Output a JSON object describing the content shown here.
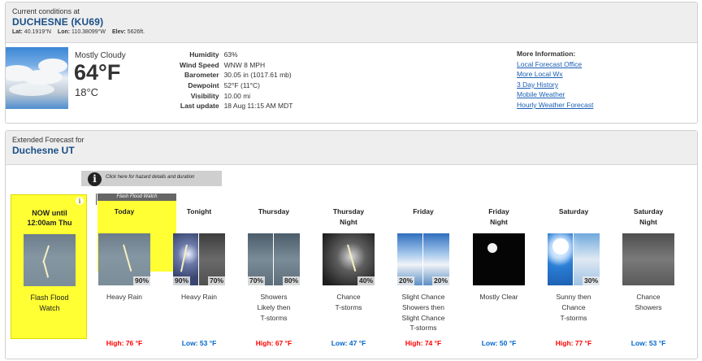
{
  "current": {
    "header_label": "Current conditions at",
    "station": "DUCHESNE (KU69)",
    "lat_label": "Lat:",
    "lat": "40.1919°N",
    "lon_label": "Lon:",
    "lon": "110.38099°W",
    "elev_label": "Elev:",
    "elev": "5626ft.",
    "condition": "Mostly Cloudy",
    "temp_f": "64°F",
    "temp_c": "18°C",
    "details": [
      {
        "label": "Humidity",
        "value": "63%"
      },
      {
        "label": "Wind Speed",
        "value": "WNW 8 MPH"
      },
      {
        "label": "Barometer",
        "value": "30.05 in (1017.61 mb)"
      },
      {
        "label": "Dewpoint",
        "value": "52°F (11°C)"
      },
      {
        "label": "Visibility",
        "value": "10.00 mi"
      },
      {
        "label": "Last update",
        "value": "18 Aug 11:15 AM MDT"
      }
    ],
    "more_title": "More Information:",
    "more_links": [
      "Local Forecast Office",
      "More Local Wx",
      "3 Day History",
      "Mobile Weather",
      "Hourly Weather Forecast"
    ]
  },
  "extended": {
    "header_label": "Extended Forecast for",
    "location": "Duchesne UT",
    "hazard_note": "Click here for hazard details and duration",
    "hazard_banner": "Flash Flood Watch",
    "now": {
      "title_line1": "NOW until",
      "title_line2": "12:00am Thu",
      "desc_line1": "Flash Flood",
      "desc_line2": "Watch"
    },
    "periods": [
      {
        "name": [
          "Today",
          ""
        ],
        "pop_left": "",
        "pop_right": "90%",
        "short": [
          "Heavy Rain"
        ],
        "temp": "High: 76 °F",
        "kind": "high"
      },
      {
        "name": [
          "Tonight",
          ""
        ],
        "pop_left": "90%",
        "pop_right": "70%",
        "short": [
          "Heavy Rain"
        ],
        "temp": "Low: 53 °F",
        "kind": "low"
      },
      {
        "name": [
          "Thursday",
          ""
        ],
        "pop_left": "70%",
        "pop_right": "80%",
        "short": [
          "Showers",
          "Likely then",
          "T-storms"
        ],
        "temp": "High: 67 °F",
        "kind": "high"
      },
      {
        "name": [
          "Thursday",
          "Night"
        ],
        "pop_left": "",
        "pop_right": "40%",
        "short": [
          "Chance",
          "T-storms"
        ],
        "temp": "Low: 47 °F",
        "kind": "low"
      },
      {
        "name": [
          "Friday",
          ""
        ],
        "pop_left": "20%",
        "pop_right": "20%",
        "short": [
          "Slight Chance",
          "Showers then",
          "Slight Chance",
          "T-storms"
        ],
        "temp": "High: 74 °F",
        "kind": "high"
      },
      {
        "name": [
          "Friday",
          "Night"
        ],
        "pop_left": "",
        "pop_right": "",
        "short": [
          "Mostly Clear"
        ],
        "temp": "Low: 50 °F",
        "kind": "low"
      },
      {
        "name": [
          "Saturday",
          ""
        ],
        "pop_left": "",
        "pop_right": "30%",
        "short": [
          "Sunny then",
          "Chance",
          "T-storms"
        ],
        "temp": "High: 77 °F",
        "kind": "high"
      },
      {
        "name": [
          "Saturday",
          "Night"
        ],
        "pop_left": "",
        "pop_right": "",
        "short": [
          "Chance",
          "Showers"
        ],
        "temp": "Low: 53 °F",
        "kind": "low"
      }
    ]
  },
  "colors": {
    "link": "#1a5fb4",
    "heading": "#1a4f87",
    "high": "#ff0000",
    "low": "#0066cc",
    "hazard": "#ffff33"
  },
  "icons": [
    "info-icon",
    "mostly-cloudy-icon",
    "heavy-rain-icon",
    "thunderstorm-icon",
    "showers-icon",
    "night-clear-icon",
    "sunny-icon"
  ]
}
